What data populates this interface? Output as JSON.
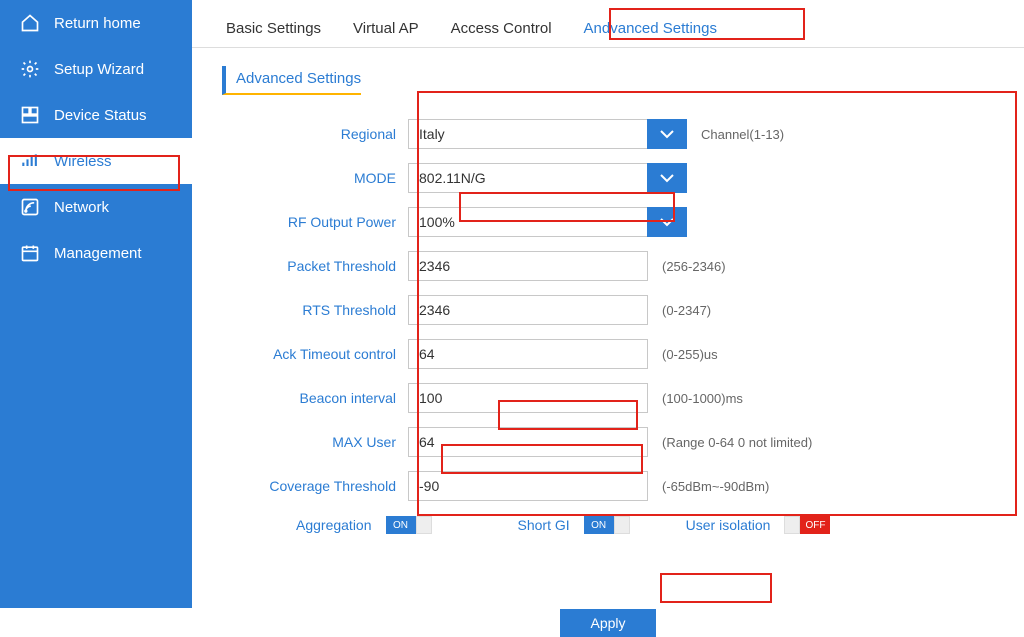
{
  "sidebar": {
    "items": [
      {
        "label": "Return home"
      },
      {
        "label": "Setup Wizard"
      },
      {
        "label": "Device Status"
      },
      {
        "label": "Wireless"
      },
      {
        "label": "Network"
      },
      {
        "label": "Management"
      }
    ]
  },
  "tabs": [
    {
      "label": "Basic Settings"
    },
    {
      "label": "Virtual AP"
    },
    {
      "label": "Access Control"
    },
    {
      "label": "Andvanced Settings"
    }
  ],
  "page_title": "Advanced Settings",
  "form": {
    "regional": {
      "label": "Regional",
      "value": "Italy",
      "hint": "Channel(1-13)"
    },
    "mode": {
      "label": "MODE",
      "value": "802.11N/G"
    },
    "rf_output_power": {
      "label": "RF Output Power",
      "value": "100%"
    },
    "packet_threshold": {
      "label": "Packet Threshold",
      "value": "2346",
      "hint": "(256-2346)"
    },
    "rts_threshold": {
      "label": "RTS Threshold",
      "value": "2346",
      "hint": "(0-2347)"
    },
    "ack_timeout": {
      "label": "Ack Timeout control",
      "value": "64",
      "hint": "(0-255)us"
    },
    "beacon_interval": {
      "label": "Beacon interval",
      "value": "100",
      "hint": "(100-1000)ms"
    },
    "max_user": {
      "label": "MAX User",
      "value": "64",
      "hint": "(Range 0-64 0 not limited)"
    },
    "coverage_threshold": {
      "label": "Coverage Threshold",
      "value": "-90",
      "hint": "(-65dBm~-90dBm)"
    }
  },
  "toggles": {
    "aggregation": {
      "label": "Aggregation",
      "state": "ON"
    },
    "short_gi": {
      "label": "Short GI",
      "state": "ON"
    },
    "user_isolation": {
      "label": "User isolation",
      "state": "OFF"
    }
  },
  "apply_label": "Apply"
}
